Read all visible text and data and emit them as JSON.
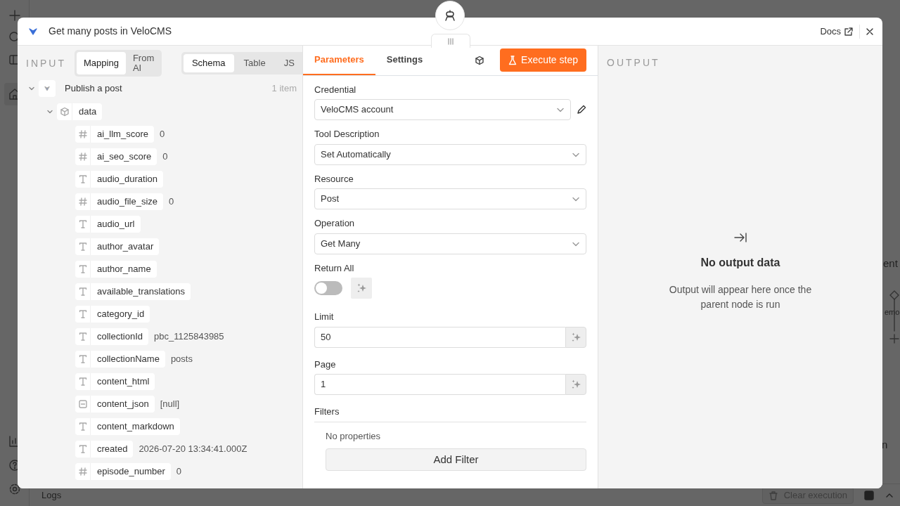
{
  "app": {
    "logs_label": "Logs",
    "clear_button": "Clear execution",
    "canvas_fragments": [
      {
        "text": "ent"
      },
      {
        "text": "emo"
      },
      {
        "text": "n"
      }
    ]
  },
  "modal": {
    "title": "Get many posts in VeloCMS",
    "docs_link": "Docs",
    "input": {
      "label": "INPUT",
      "mode_tabs": [
        {
          "label": "Mapping",
          "selected": true
        },
        {
          "label": "From AI",
          "selected": false
        }
      ],
      "view_tabs": [
        {
          "label": "Schema",
          "selected": true
        },
        {
          "label": "Table",
          "selected": false
        },
        {
          "label": "JS",
          "selected": false
        }
      ],
      "tree": [
        {
          "kind": "node",
          "label": "Publish a post",
          "count": "1 item",
          "expanded": true,
          "children": [
            {
              "kind": "object",
              "label": "data",
              "expanded": true,
              "children": [
                {
                  "kind": "number",
                  "label": "ai_llm_score",
                  "value": "0"
                },
                {
                  "kind": "number",
                  "label": "ai_seo_score",
                  "value": "0"
                },
                {
                  "kind": "string",
                  "label": "audio_duration"
                },
                {
                  "kind": "number",
                  "label": "audio_file_size",
                  "value": "0"
                },
                {
                  "kind": "string",
                  "label": "audio_url"
                },
                {
                  "kind": "string",
                  "label": "author_avatar"
                },
                {
                  "kind": "string",
                  "label": "author_name"
                },
                {
                  "kind": "string",
                  "label": "available_translations"
                },
                {
                  "kind": "string",
                  "label": "category_id"
                },
                {
                  "kind": "string",
                  "label": "collectionId",
                  "value": "pbc_1125843985"
                },
                {
                  "kind": "string",
                  "label": "collectionName",
                  "value": "posts"
                },
                {
                  "kind": "string",
                  "label": "content_html"
                },
                {
                  "kind": "null",
                  "label": "content_json",
                  "value": "[null]"
                },
                {
                  "kind": "string",
                  "label": "content_markdown"
                },
                {
                  "kind": "string",
                  "label": "created",
                  "value": "2026-07-20 13:34:41.000Z"
                },
                {
                  "kind": "number",
                  "label": "episode_number",
                  "value": "0"
                }
              ]
            }
          ]
        }
      ]
    },
    "parameters": {
      "tabs": [
        {
          "label": "Parameters",
          "selected": true
        },
        {
          "label": "Settings",
          "selected": false
        }
      ],
      "execute_button": "Execute step",
      "fields": [
        {
          "kind": "credential",
          "label": "Credential",
          "value": "VeloCMS account"
        },
        {
          "kind": "select",
          "label": "Tool Description",
          "value": "Set Automatically"
        },
        {
          "kind": "select",
          "label": "Resource",
          "value": "Post"
        },
        {
          "kind": "select",
          "label": "Operation",
          "value": "Get Many"
        },
        {
          "kind": "toggle",
          "label": "Return All",
          "on": false
        },
        {
          "kind": "input",
          "label": "Limit",
          "value": "50"
        },
        {
          "kind": "input",
          "label": "Page",
          "value": "1"
        },
        {
          "kind": "collection",
          "label": "Filters",
          "empty_text": "No properties",
          "button": "Add Filter"
        }
      ]
    },
    "output": {
      "label": "OUTPUT",
      "empty_title": "No output data",
      "empty_text": "Output will appear here once the parent node is run"
    }
  }
}
